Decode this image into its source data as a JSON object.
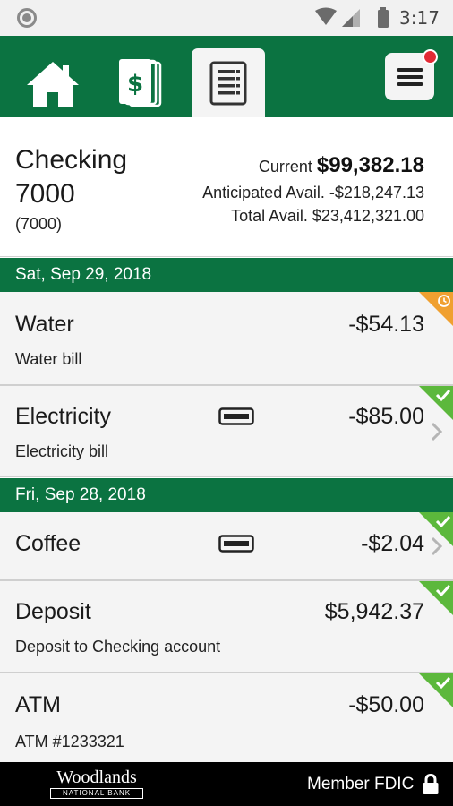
{
  "status_bar": {
    "time": "3:17",
    "icons": [
      "notification-circle-icon",
      "wifi-icon",
      "signal-icon",
      "battery-icon"
    ]
  },
  "tabs": [
    {
      "icon": "home-icon",
      "active": false
    },
    {
      "icon": "money-icon",
      "active": false
    },
    {
      "icon": "activity-list-icon",
      "active": true
    }
  ],
  "menu": {
    "icon": "hamburger-menu-icon",
    "has_notification": true
  },
  "account": {
    "name": "Checking 7000",
    "number": "(7000)",
    "current_label": "Current",
    "current_value": "$99,382.18",
    "anticipated": "Anticipated Avail. -$218,247.13",
    "total": "Total Avail. $23,412,321.00"
  },
  "groups": [
    {
      "date": "Sat, Sep 29, 2018",
      "transactions": [
        {
          "title": "Water",
          "desc": "Water bill",
          "amount": "-$54.13",
          "status": "pending",
          "card": false,
          "chevron": false
        },
        {
          "title": "Electricity",
          "desc": "Electricity bill",
          "amount": "-$85.00",
          "status": "cleared",
          "card": true,
          "chevron": true
        }
      ]
    },
    {
      "date": "Fri, Sep 28, 2018",
      "transactions": [
        {
          "title": "Coffee",
          "desc": "",
          "amount": "-$2.04",
          "status": "cleared",
          "card": true,
          "chevron": true
        },
        {
          "title": "Deposit",
          "desc": "Deposit to Checking account",
          "amount": "$5,942.37",
          "status": "cleared",
          "card": false,
          "chevron": false
        },
        {
          "title": "ATM",
          "desc": "ATM #1233321",
          "amount": "-$50.00",
          "status": "cleared",
          "card": false,
          "chevron": false
        }
      ]
    }
  ],
  "footer": {
    "logo_name": "Woodlands",
    "logo_sub": "NATIONAL BANK",
    "fdic": "Member FDIC"
  },
  "colors": {
    "brand_green": "#0b7341",
    "pending_orange": "#f0a030",
    "cleared_green": "#5cb83c",
    "notification_red": "#e22a35"
  }
}
